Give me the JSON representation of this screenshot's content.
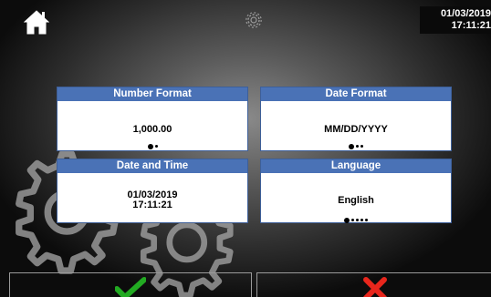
{
  "header": {
    "home_icon": "home-icon",
    "settings_icon": "gear-icon",
    "datetime_date": "01/03/2019",
    "datetime_time": "17:11:21"
  },
  "cards": {
    "number_format": {
      "title": "Number Format",
      "value": "1,000.00",
      "selected_option": 1,
      "option_count": 2
    },
    "date_format": {
      "title": "Date Format",
      "value": "MM/DD/YYYY",
      "selected_option": 1,
      "option_count": 3
    },
    "date_time": {
      "title": "Date and Time",
      "date": "01/03/2019",
      "time": "17:11:21"
    },
    "language": {
      "title": "Language",
      "value": "English",
      "selected_option": 1,
      "option_count": 5
    }
  },
  "footer": {
    "confirm_icon": "checkmark-icon",
    "cancel_icon": "x-icon",
    "confirm_color": "#22aa22",
    "cancel_color": "#e8261c"
  },
  "colors": {
    "card_header": "#4a72b6"
  }
}
